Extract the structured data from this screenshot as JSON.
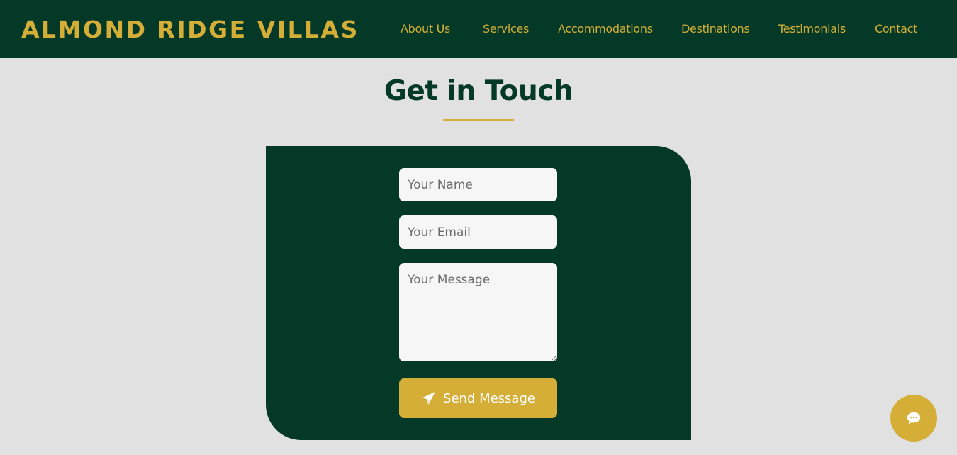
{
  "header": {
    "brand": "ALMOND RIDGE VILLAS",
    "nav": [
      "About Us",
      "Services",
      "Accommodations",
      "Destinations",
      "Testimonials",
      "Contact"
    ]
  },
  "contact": {
    "title": "Get in Touch",
    "name_placeholder": "Your Name",
    "email_placeholder": "Your Email",
    "message_placeholder": "Your Message",
    "send_label": "Send Message",
    "send_icon": "paper-plane-icon"
  },
  "chat": {
    "icon": "chat-bubble-icon"
  },
  "colors": {
    "primary": "#043927",
    "accent": "#d4ae36",
    "background": "#e1e1e1",
    "input": "#f6f6f6"
  }
}
